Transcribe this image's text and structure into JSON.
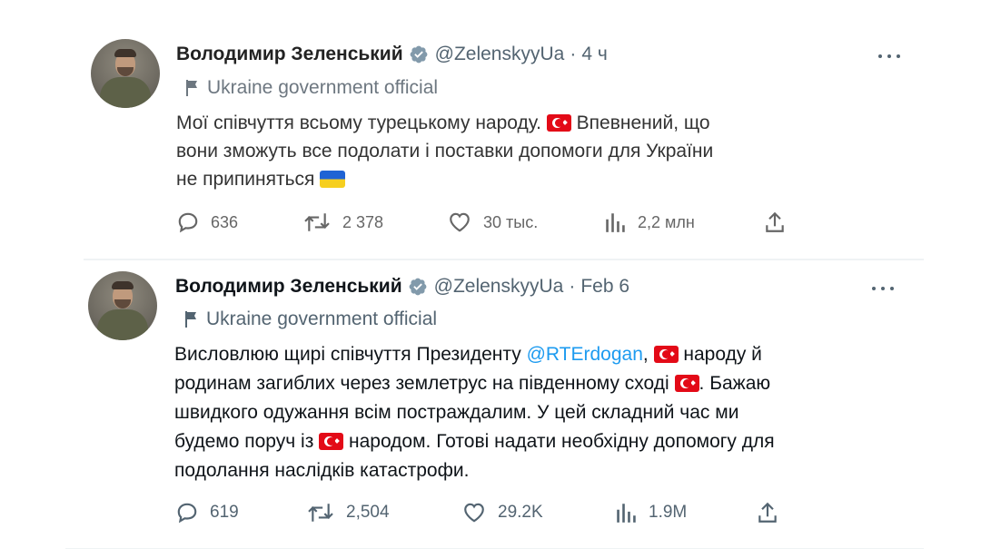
{
  "tweets": [
    {
      "author": "Володимир Зеленський",
      "handle": "@ZelenskyyUa",
      "separator": "·",
      "time": "4 ч",
      "gov_label": "Ukraine government official",
      "text_lines": [
        [
          "Мої співчуття всьому турецькому народу. ",
          "FLAG_TR",
          " Впевнений, що"
        ],
        [
          "вони зможуть все подолати і поставки допомоги для України"
        ],
        [
          "не припиняться ",
          "FLAG_UA"
        ]
      ],
      "stats": {
        "replies": "636",
        "retweets": "2 378",
        "likes": "30 тыс.",
        "views": "2,2 млн"
      }
    },
    {
      "author": "Володимир Зеленський",
      "handle": "@ZelenskyyUa",
      "separator": "·",
      "time": "Feb 6",
      "gov_label": "Ukraine government official",
      "text_lines": [
        [
          "Висловлюю щирі співчуття Президенту ",
          "@RTErdogan",
          ", ",
          "FLAG_TR",
          " народу й"
        ],
        [
          "родинам загиблих через землетрус на південному сході ",
          "FLAG_TR",
          ". Бажаю"
        ],
        [
          "швидкого одужання всім постраждалим. У цей складний час ми"
        ],
        [
          "будемо поруч із ",
          "FLAG_TR",
          " народом. Готові надати необхідну допомогу для"
        ],
        [
          "подолання наслідків катастрофи."
        ]
      ],
      "stats": {
        "replies": "619",
        "retweets": "2,504",
        "likes": "29.2K",
        "views": "1.9M"
      }
    }
  ],
  "icons": {
    "verified": "verified-badge-icon",
    "gov": "flag-icon",
    "more": "more-options-icon",
    "reply": "reply-icon",
    "retweet": "retweet-icon",
    "like": "heart-icon",
    "views": "views-chart-icon",
    "share": "share-icon"
  },
  "colors": {
    "link": "#1d9bf0",
    "secondary_text": "#536471",
    "verified": "#829aab",
    "flag_tr": "#e30a17",
    "flag_ua_blue": "#1f63d4",
    "flag_ua_yellow": "#f6cf1f"
  }
}
